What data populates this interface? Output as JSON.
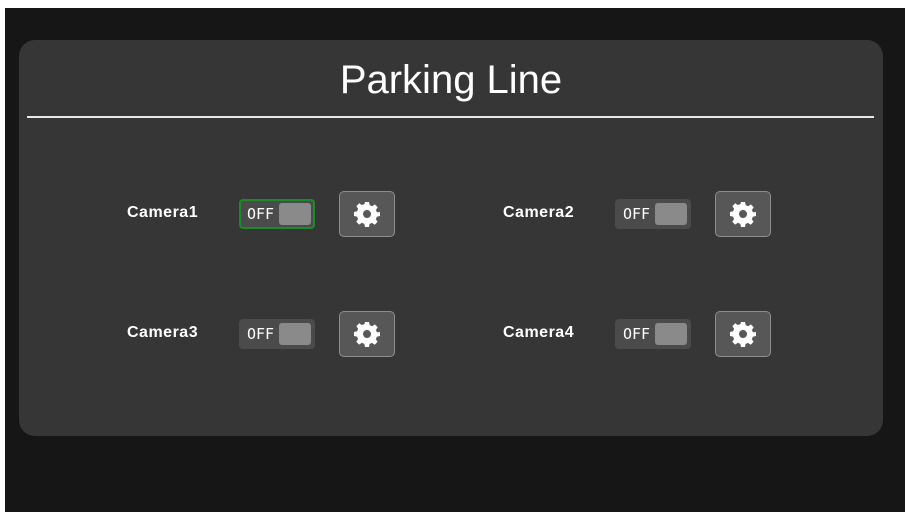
{
  "page": {
    "title": "Parking Line"
  },
  "cameras": [
    {
      "label": "Camera1",
      "toggle_text": "OFF",
      "focused": true,
      "settings_icon": "gear-icon"
    },
    {
      "label": "Camera2",
      "toggle_text": "OFF",
      "focused": false,
      "settings_icon": "gear-icon"
    },
    {
      "label": "Camera3",
      "toggle_text": "OFF",
      "focused": false,
      "settings_icon": "gear-icon"
    },
    {
      "label": "Camera4",
      "toggle_text": "OFF",
      "focused": false,
      "settings_icon": "gear-icon"
    }
  ],
  "colors": {
    "background": "#161616",
    "panel": "#363636",
    "focus_border": "#1f8a2c",
    "toggle_bg": "#4b4b4b",
    "toggle_knob": "#8a8a8a",
    "button_bg": "#575757"
  }
}
